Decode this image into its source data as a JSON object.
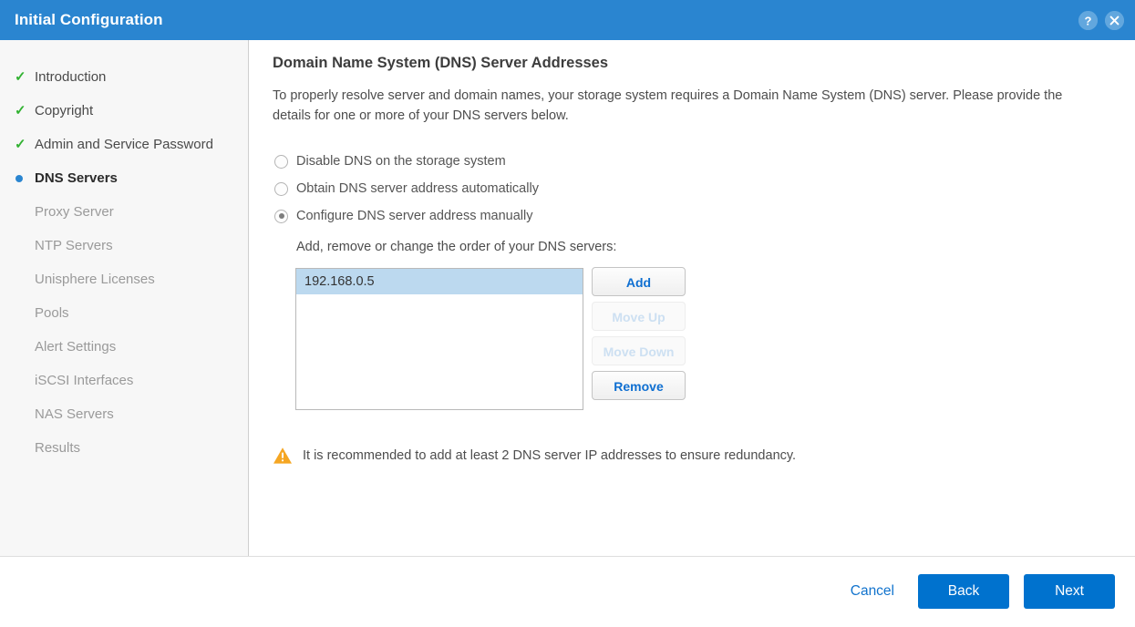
{
  "window": {
    "title": "Initial Configuration",
    "help_icon": "help-circle-icon",
    "close_icon": "close-circle-icon",
    "titlebar_color": "#2a85d0"
  },
  "sidebar": {
    "items": [
      {
        "label": "Introduction",
        "state": "done",
        "marker": "check-icon"
      },
      {
        "label": "Copyright",
        "state": "done",
        "marker": "check-icon"
      },
      {
        "label": "Admin and Service Password",
        "state": "done",
        "marker": "check-icon"
      },
      {
        "label": "DNS Servers",
        "state": "active",
        "marker": "bullet-dot-icon"
      },
      {
        "label": "Proxy Server",
        "state": "pending",
        "marker": ""
      },
      {
        "label": "NTP Servers",
        "state": "pending",
        "marker": ""
      },
      {
        "label": "Unisphere Licenses",
        "state": "pending",
        "marker": ""
      },
      {
        "label": "Pools",
        "state": "pending",
        "marker": ""
      },
      {
        "label": "Alert Settings",
        "state": "pending",
        "marker": ""
      },
      {
        "label": "iSCSI Interfaces",
        "state": "pending",
        "marker": ""
      },
      {
        "label": "NAS Servers",
        "state": "pending",
        "marker": ""
      },
      {
        "label": "Results",
        "state": "pending",
        "marker": ""
      }
    ],
    "check_color": "#32b232",
    "active_dot_color": "#2a85d0"
  },
  "main": {
    "title": "Domain Name System (DNS) Server Addresses",
    "description": "To properly resolve server and domain names, your storage system requires a Domain Name System (DNS) server. Please provide the details for one or more of your DNS servers below.",
    "radio_options": [
      {
        "label": "Disable DNS on the storage system",
        "selected": false
      },
      {
        "label": "Obtain DNS server address automatically",
        "selected": false
      },
      {
        "label": "Configure DNS server address manually",
        "selected": true
      }
    ],
    "list_caption": "Add, remove or change the order of your DNS servers:",
    "dns_servers": [
      {
        "address": "192.168.0.5",
        "selected": true
      }
    ],
    "list_buttons": [
      {
        "label": "Add",
        "enabled": true
      },
      {
        "label": "Move Up",
        "enabled": false
      },
      {
        "label": "Move Down",
        "enabled": false
      },
      {
        "label": "Remove",
        "enabled": true
      }
    ],
    "warning": {
      "icon": "warning-triangle-icon",
      "text": "It is recommended to add at least 2 DNS server IP addresses to ensure redundancy.",
      "color": "#f5a623"
    },
    "selection_color": "#bcd9ef"
  },
  "footer": {
    "cancel_label": "Cancel",
    "back_label": "Back",
    "next_label": "Next",
    "primary_color": "#0072ce",
    "link_color": "#1173cd"
  }
}
